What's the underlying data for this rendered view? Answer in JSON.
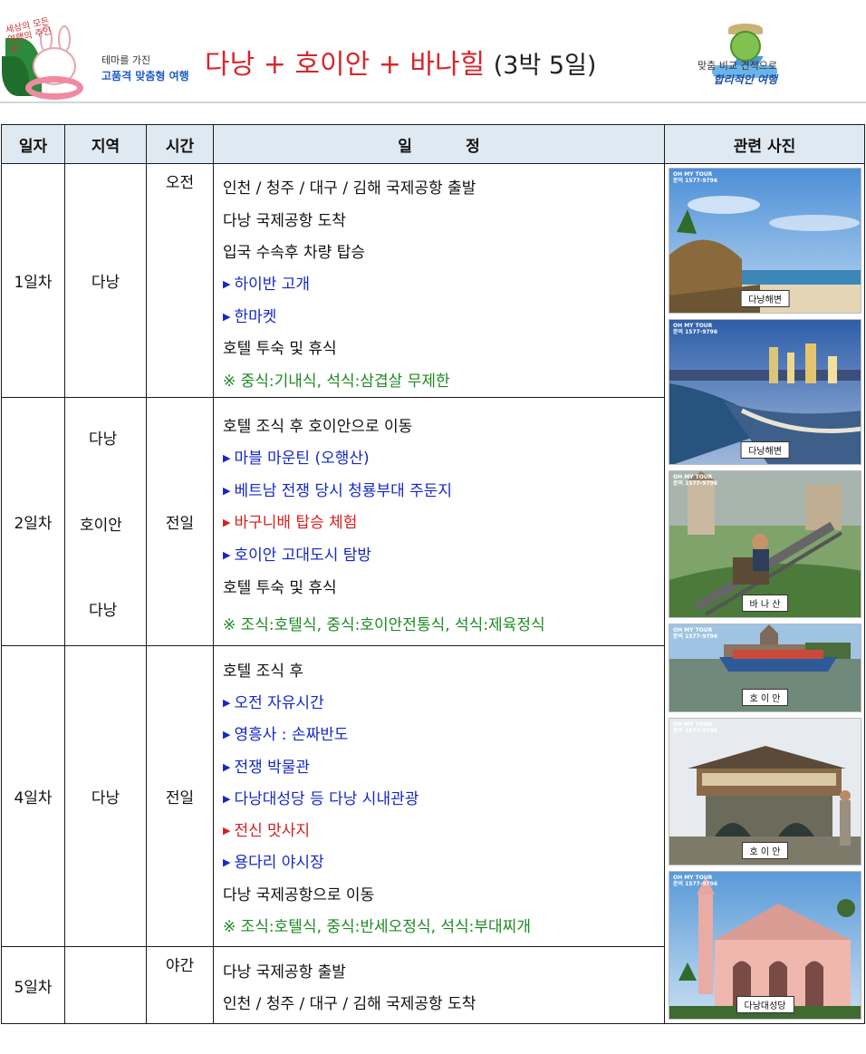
{
  "header": {
    "logo_script": "세상의 모든 여행의 주인공!",
    "left_line1": "테마를 가진",
    "left_line2": "고품격 맞춤형 여행",
    "title_main": "다낭 + 호이안 + 바나힐",
    "title_duration": "(3박 5일)",
    "right_line1": "맞춤 비교 견적으로",
    "right_line2": "합리적인 여행"
  },
  "table": {
    "headers": {
      "day": "일자",
      "region": "지역",
      "time": "시간",
      "schedule": "일          정",
      "photo": "관련 사진"
    },
    "day1": {
      "day": "1일차",
      "region": "다낭",
      "time": "오전",
      "lines": [
        "인천 / 청주 / 대구 / 김해 국제공항 출발",
        "다낭 국제공항 도착",
        "입국 수속후 차량 탑승",
        "하이반 고개",
        "한마켓",
        "호텔 투숙 및 휴식",
        "※ 중식:기내식, 석식:삼겹살 무제한"
      ]
    },
    "day2": {
      "day": "2일차",
      "region1": "다낭",
      "region2": "호이안",
      "region3": "다낭",
      "time": "전일",
      "lines": [
        "호텔 조식 후 호이안으로 이동",
        "마블 마운틴 (오행산)",
        "베트남 전쟁 당시 청룡부대 주둔지",
        "바구니배 탑승 체험",
        "호이안 고대도시 탐방",
        "호텔 투숙 및 휴식",
        "※ 조식:호텔식, 중식:호이안전통식, 석식:제육정식"
      ]
    },
    "day4": {
      "day": "4일차",
      "region": "다낭",
      "time": "전일",
      "lines": [
        "호텔 조식 후",
        "오전 자유시간",
        "영흥사 : 손짜반도",
        "전쟁 박물관",
        "다낭대성당 등 다낭 시내관광",
        "전신 맛사지",
        "용다리 야시장",
        "다낭 국제공항으로 이동",
        "※ 조식:호텔식, 중식:반세오정식, 석식:부대찌개"
      ]
    },
    "day5": {
      "day": "5일차",
      "region": "",
      "time": "야간",
      "lines": [
        "다낭 국제공항 출발",
        "인천 / 청주 / 대구 / 김해 국제공항 도착"
      ]
    }
  },
  "photos": {
    "watermark": "OH MY TOUR\n문의 1577-9796",
    "captions": [
      "다낭해변",
      "다낭해변",
      "바 나 산",
      "호 이 안",
      "호 이 안",
      "다낭대성당"
    ]
  },
  "colors": {
    "blue_text": "#1428c8",
    "red_text": "#d81e1e",
    "green_text": "#1e8a22",
    "header_bg": "#dfe9f1",
    "title_red": "#d7262b"
  }
}
